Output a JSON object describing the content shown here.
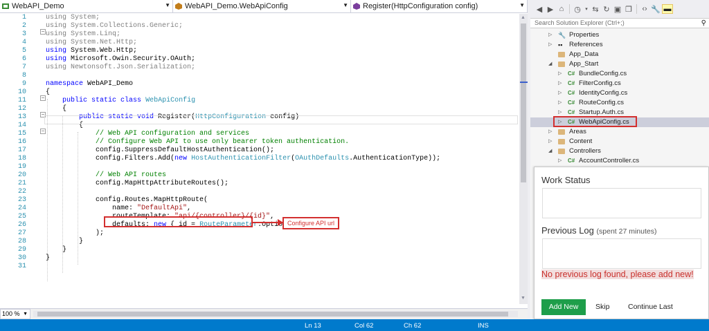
{
  "editor": {
    "nav": {
      "project": "WebAPI_Demo",
      "class": "WebAPI_Demo.WebApiConfig",
      "member": "Register(HttpConfiguration config)"
    },
    "zoom": "100 %",
    "line_numbers": [
      "1",
      "2",
      "3",
      "4",
      "5",
      "6",
      "7",
      "8",
      "9",
      "10",
      "11",
      "12",
      "13",
      "14",
      "15",
      "16",
      "17",
      "18",
      "19",
      "20",
      "21",
      "22",
      "23",
      "24",
      "25",
      "26",
      "27",
      "28",
      "29",
      "30",
      "31"
    ],
    "code": {
      "l1_kw": "using",
      "l1_rest": " System;",
      "l2_kw": "using",
      "l2_rest": " System.Collections.Generic;",
      "l3_kw": "using",
      "l3_rest": " System.Linq;",
      "l4_kw": "using",
      "l4_rest": " System.Net.Http;",
      "l5_kw": "using",
      "l5_rest": " System.Web.Http;",
      "l6_kw": "using",
      "l6_rest": " Microsoft.Owin.Security.OAuth;",
      "l7_kw": "using",
      "l7_rest": " Newtonsoft.Json.Serialization;",
      "l9_kw": "namespace",
      "l9_rest": " WebAPI_Demo",
      "l10": "{",
      "l11_kw": "public static class",
      "l11_ty": "WebApiConfig",
      "l12": "{",
      "l13_kw": "public static void",
      "l13_a": " Register(",
      "l13_ty": "HttpConfiguration",
      "l13_b": " config)",
      "l14": "{",
      "l15": "// Web API configuration and services",
      "l16": "// Configure Web API to use only bearer token authentication.",
      "l17": "config.SuppressDefaultHostAuthentication();",
      "l18_a": "config.Filters.Add(",
      "l18_kw": "new",
      "l18_ty1": "HostAuthenticationFilter",
      "l18_b": "(",
      "l18_ty2": "OAuthDefaults",
      "l18_c": ".AuthenticationType));",
      "l20": "// Web API routes",
      "l21": "config.MapHttpAttributeRoutes();",
      "l23": "config.Routes.MapHttpRoute(",
      "l24_a": "name: ",
      "l24_st": "\"DefaultApi\"",
      "l24_b": ",",
      "l25_a": "routeTemplate: ",
      "l25_st": "\"api/{controller}/{id}\"",
      "l25_b": ",",
      "l26_a": "defaults: ",
      "l26_kw": "new",
      "l26_b": " { id = ",
      "l26_ty": "RouteParameter",
      "l26_c": ".Optional }",
      "l27": ");",
      "l28": "}",
      "l29": "}",
      "l30": "}"
    },
    "callout": "Configure API url"
  },
  "solution_explorer": {
    "search_placeholder": "Search Solution Explorer (Ctrl+;)",
    "items": [
      {
        "label": "Properties"
      },
      {
        "label": "References"
      },
      {
        "label": "App_Data"
      },
      {
        "label": "App_Start"
      },
      {
        "label": "BundleConfig.cs"
      },
      {
        "label": "FilterConfig.cs"
      },
      {
        "label": "IdentityConfig.cs"
      },
      {
        "label": "RouteConfig.cs"
      },
      {
        "label": "Startup.Auth.cs"
      },
      {
        "label": "WebApiConfig.cs"
      },
      {
        "label": "Areas"
      },
      {
        "label": "Content"
      },
      {
        "label": "Controllers"
      },
      {
        "label": "AccountController.cs"
      }
    ],
    "cs_badge": "C#"
  },
  "work_popup": {
    "work_status_label": "Work Status",
    "previous_log_label": "Previous Log",
    "spent_label": "(spent 27 minutes)",
    "no_log_message": "No previous log found, please add new!",
    "add_new": "Add New",
    "skip": "Skip",
    "continue_last": "Continue Last"
  },
  "status_bar": {
    "ln": "Ln 13",
    "col": "Col 62",
    "ch": "Ch 62",
    "ins": "INS"
  },
  "colors": {
    "status_bar": "#007acc",
    "keyword": "#0000ff",
    "type": "#2b91af",
    "comment": "#008000",
    "string": "#a31515",
    "annotation_red": "#d32f2f",
    "add_button": "#1e9e4a"
  }
}
